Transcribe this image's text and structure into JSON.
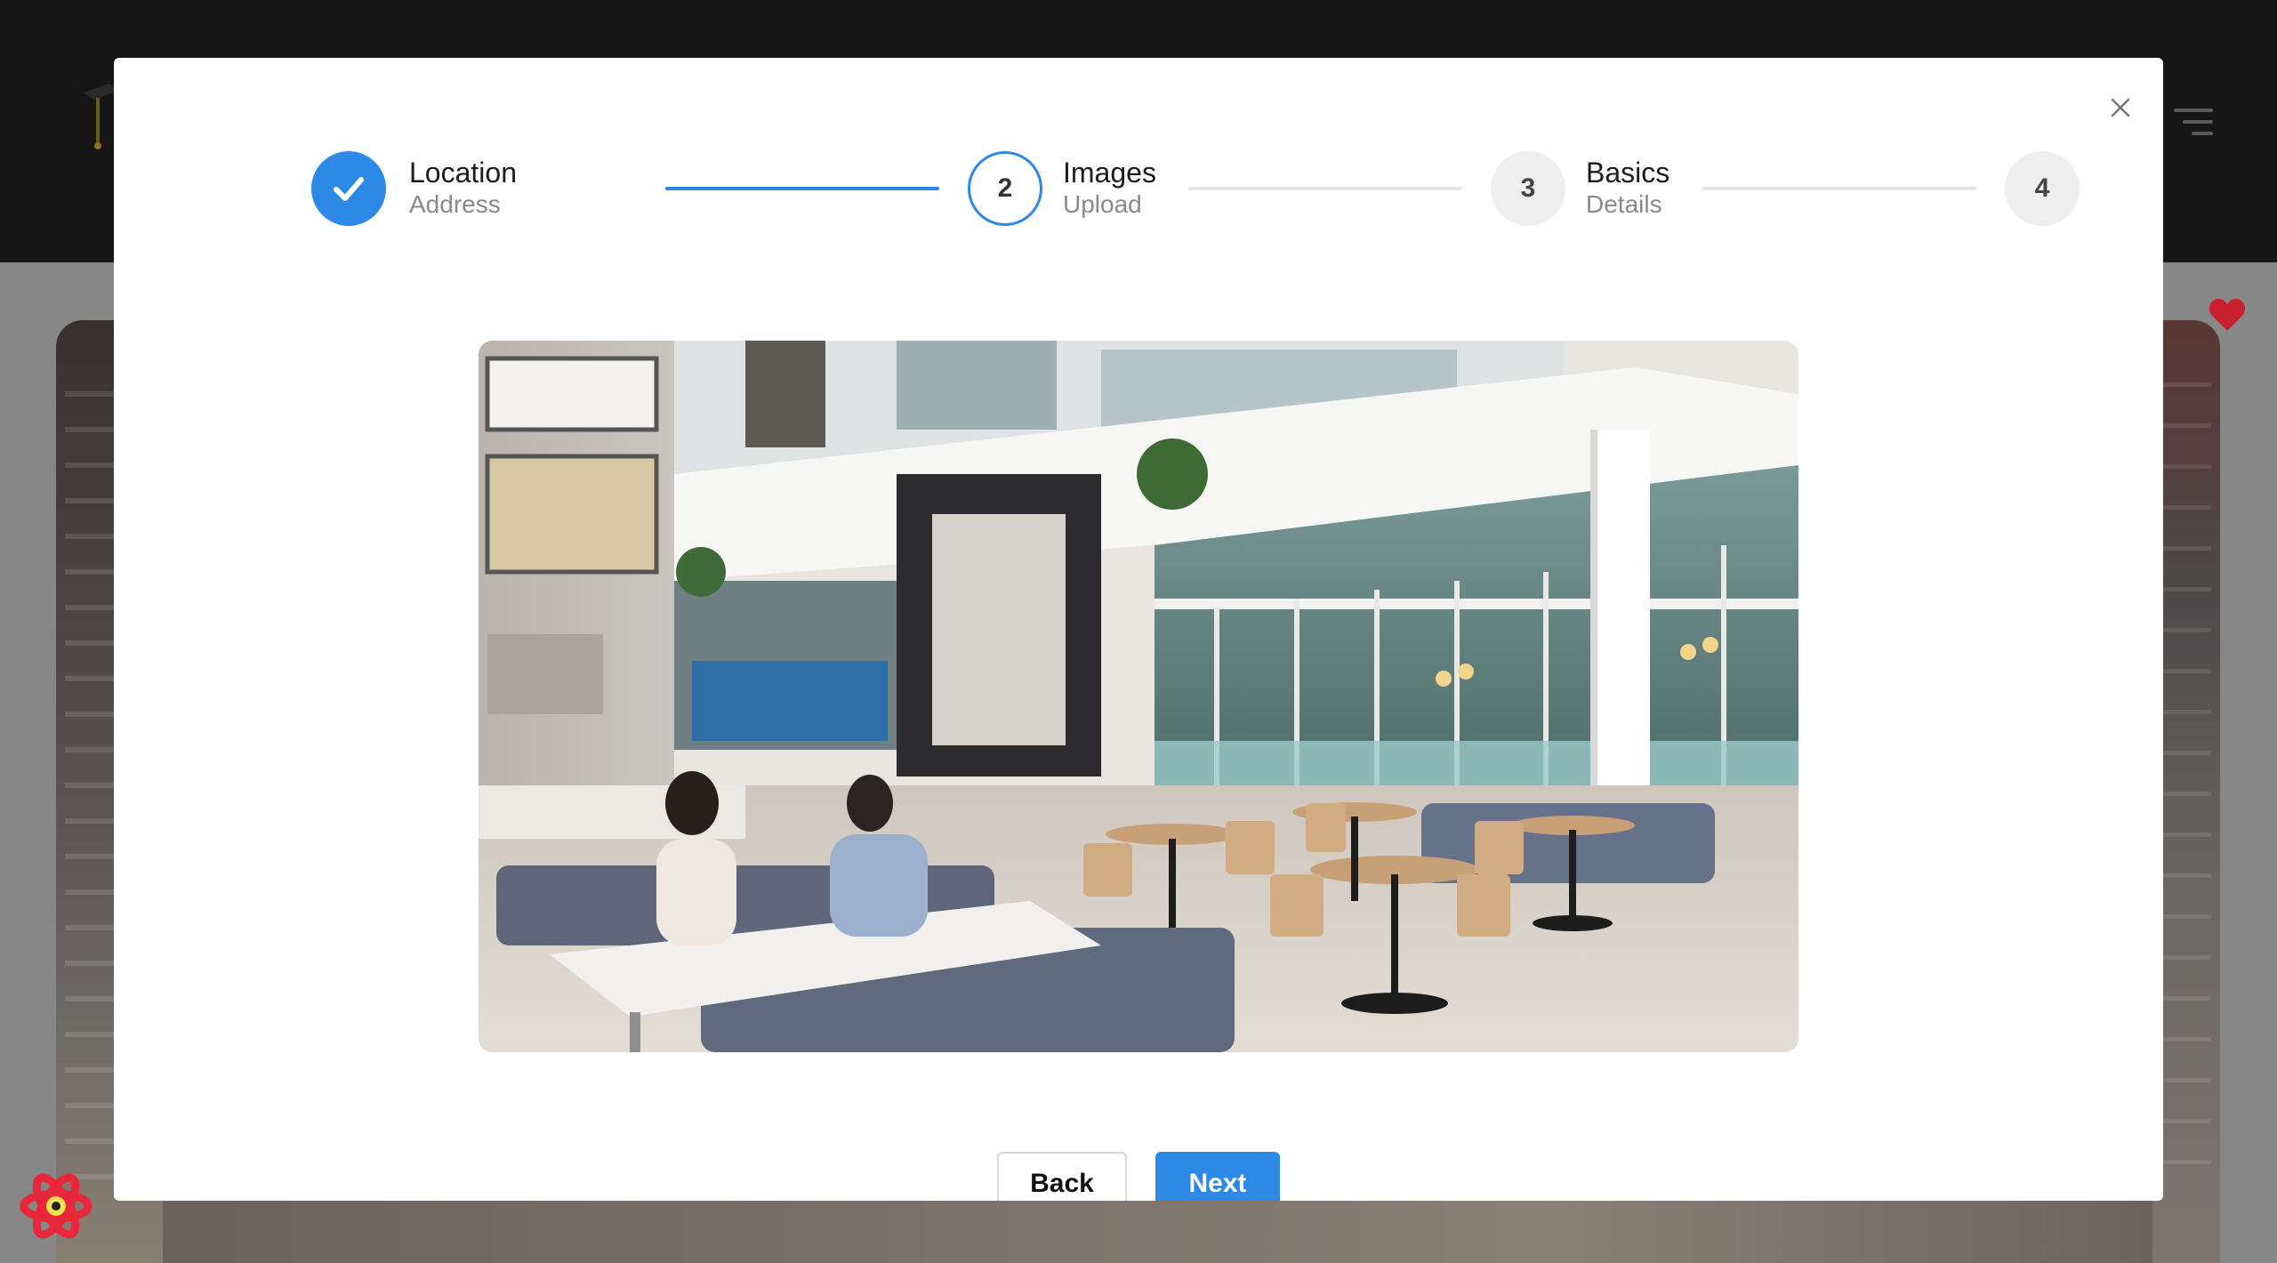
{
  "modal": {
    "steps": [
      {
        "number": "1",
        "title": "Location",
        "subtitle": "Address",
        "state": "complete"
      },
      {
        "number": "2",
        "title": "Images",
        "subtitle": "Upload",
        "state": "active"
      },
      {
        "number": "3",
        "title": "Basics",
        "subtitle": "Details",
        "state": "pending"
      },
      {
        "number": "4",
        "title": "",
        "subtitle": "",
        "state": "pending"
      }
    ],
    "close_icon": "close-icon",
    "step_done_icon": "check-icon",
    "preview_image": "uploaded-image-preview",
    "buttons": {
      "back": "Back",
      "next": "Next"
    }
  },
  "background": {
    "logo_icon": "graduation-cap-logo",
    "menu_icon": "hamburger-menu-icon",
    "favorite_icon": "heart-icon",
    "devtools_icon": "react-devtools-icon"
  },
  "colors": {
    "accent": "#2c89e5",
    "header_bg": "#161616",
    "overlay_bg": "#7d7d7d",
    "heart": "#c8202e"
  }
}
